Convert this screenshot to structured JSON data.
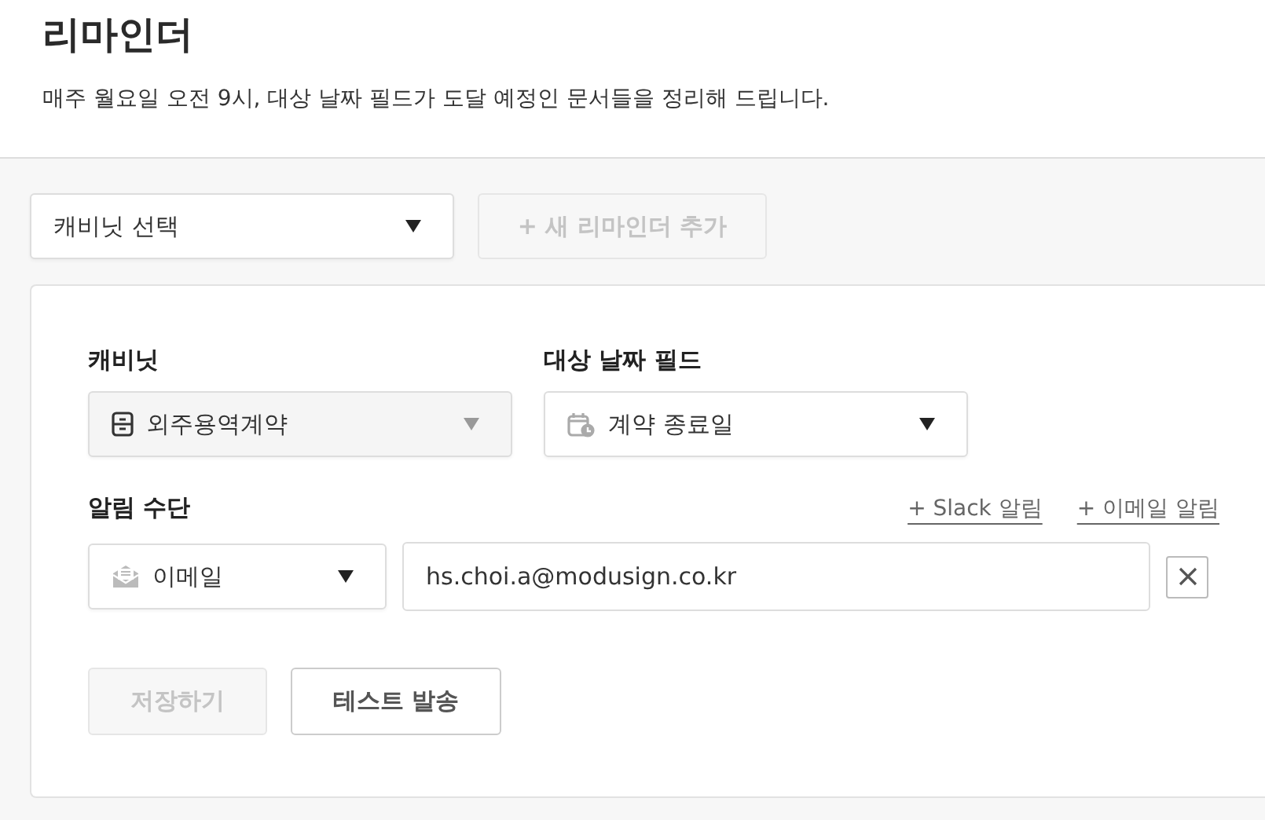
{
  "header": {
    "title": "리마인더",
    "description": "매주 월요일 오전 9시, 대상 날짜 필드가 도달 예정인 문서들을 정리해 드립니다."
  },
  "toolbar": {
    "cabinet_select": {
      "value": "캐비닛 선택"
    },
    "add_button": {
      "label": "+ 새 리마인더 추가",
      "disabled": true
    }
  },
  "form": {
    "cabinet": {
      "label": "캐비닛",
      "value": "외주용역계약",
      "disabled": true
    },
    "date_field": {
      "label": "대상 날짜 필드",
      "value": "계약 종료일",
      "disabled": false
    },
    "notification": {
      "label": "알림 수단",
      "links": [
        {
          "label": "+ Slack 알림"
        },
        {
          "label": "+ 이메일 알림"
        }
      ],
      "method": {
        "value": "이메일"
      },
      "address": {
        "value": "hs.choi.a@modusign.co.kr"
      }
    },
    "buttons": [
      {
        "label": "저장하기",
        "disabled": true
      },
      {
        "label": "테스트 발송",
        "disabled": false
      }
    ]
  }
}
